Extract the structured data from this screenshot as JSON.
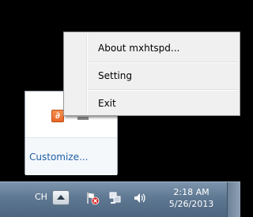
{
  "context_menu": {
    "items": [
      {
        "label": "About mxhtspd..."
      },
      {
        "label": "Setting"
      },
      {
        "label": "Exit"
      }
    ]
  },
  "overflow_panel": {
    "app_icon_glyph": "∂",
    "app_icon_name": "mxhtspd-app-icon",
    "customize_label": "Customize..."
  },
  "taskbar": {
    "language": "CH",
    "clock": {
      "time": "2:18 AM",
      "date": "5/26/2013"
    },
    "tray_icons": [
      "action-center-flag-icon",
      "network-icon",
      "volume-icon"
    ]
  },
  "colors": {
    "link": "#1e5ea8",
    "taskbar": "#5f7892",
    "app_icon": "#e8652a",
    "action_center_x": "#d62020"
  }
}
